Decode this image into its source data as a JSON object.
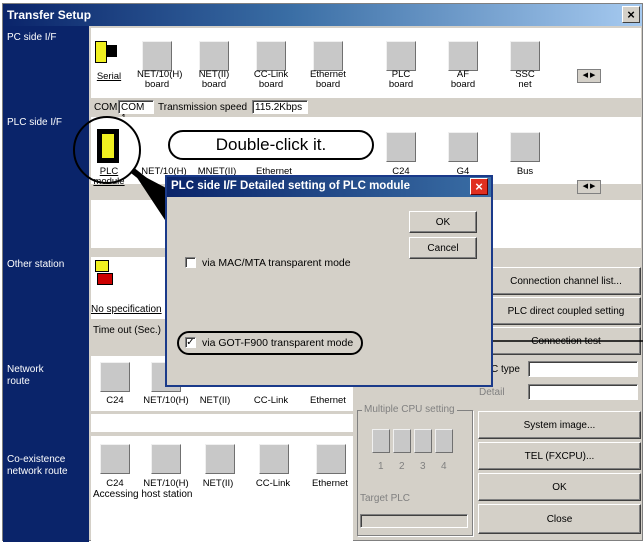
{
  "window": {
    "title": "Transfer Setup",
    "close": "×"
  },
  "pc_side": {
    "label": "PC side I/F",
    "items": [
      {
        "line1": "Serial",
        "line2": ""
      },
      {
        "line1": "NET/10(H)",
        "line2": "board"
      },
      {
        "line1": "NET(II)",
        "line2": "board"
      },
      {
        "line1": "CC-Link",
        "line2": "board"
      },
      {
        "line1": "Ethernet",
        "line2": "board"
      },
      {
        "line1": "PLC",
        "line2": "board"
      },
      {
        "line1": "AF",
        "line2": "board"
      },
      {
        "line1": "SSC",
        "line2": "net"
      }
    ],
    "com_label": "COM",
    "com_value": "COM 1",
    "speed_label": "Transmission speed",
    "speed_value": "115.2Kbps",
    "scroll": "◀ ▶"
  },
  "plc_side": {
    "label": "PLC side I/F",
    "items": [
      {
        "line1": "PLC",
        "line2": "module"
      },
      {
        "line1": "NET/10(H)",
        "line2": ""
      },
      {
        "line1": "MNET(II)",
        "line2": ""
      },
      {
        "line1": "Ethernet",
        "line2": ""
      },
      {
        "line1": "C24",
        "line2": ""
      },
      {
        "line1": "G4",
        "line2": ""
      },
      {
        "line1": "Bus",
        "line2": ""
      }
    ],
    "scroll": "◀ ▶"
  },
  "callout": "Double-click it.",
  "other_station": {
    "label": "Other station",
    "item": "No specification",
    "timeout_label": "Time out (Sec.)"
  },
  "buttons": {
    "conn_channel": "Connection channel list...",
    "plc_direct": "PLC direct coupled setting",
    "conn_test": "Connection test",
    "system_image": "System  image...",
    "tel": "TEL (FXCPU)...",
    "ok": "OK",
    "close": "Close"
  },
  "network_route": {
    "label": "Network route",
    "items": [
      "C24",
      "NET/10(H)",
      "NET(II)",
      "CC-Link",
      "Ethernet"
    ],
    "ctype": "C type",
    "detail": "Detail"
  },
  "multi_cpu": {
    "title": "Multiple CPU setting",
    "nums": [
      "1",
      "2",
      "3",
      "4"
    ],
    "target": "Target PLC"
  },
  "coexistence": {
    "label": "Co-existence network route",
    "items": [
      "C24",
      "NET/10(H)",
      "NET(II)",
      "CC-Link",
      "Ethernet"
    ],
    "status": "Accessing host station"
  },
  "dialog": {
    "title": "PLC side I/F   Detailed setting of PLC module",
    "ok": "OK",
    "cancel": "Cancel",
    "opt1": "via MAC/MTA transparent mode",
    "opt2": "via GOT-F900 transparent mode",
    "opt2_checked": "✓"
  }
}
